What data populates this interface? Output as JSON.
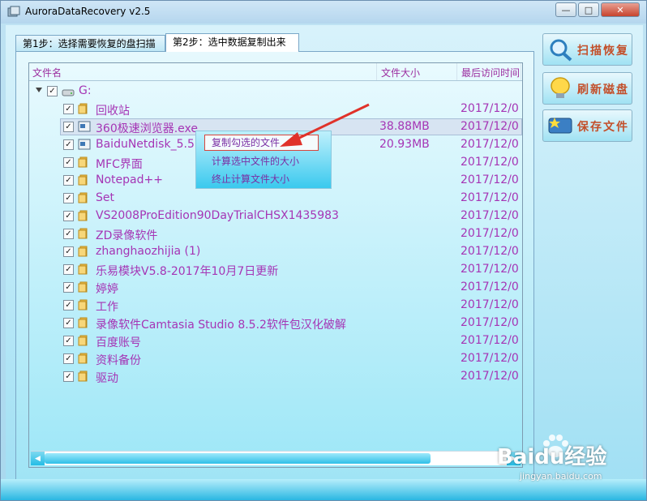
{
  "window": {
    "title": "AuroraDataRecovery v2.5"
  },
  "tabs": [
    {
      "label": "第1步：选择需要恢复的盘扫描"
    },
    {
      "label": "第2步：选中数据复制出来"
    }
  ],
  "columns": {
    "name": "文件名",
    "size": "文件大小",
    "date": "最后访问时间"
  },
  "drive": {
    "label": "G:"
  },
  "rows": [
    {
      "name": "回收站",
      "size": "",
      "date": "2017/12/0",
      "icon": "folder-icon"
    },
    {
      "name": "360极速浏览器.exe",
      "size": "38.88MB",
      "date": "2017/12/0",
      "icon": "file-icon",
      "selected": true
    },
    {
      "name": "BaiduNetdisk_5.5",
      "size": "20.93MB",
      "date": "2017/12/0",
      "icon": "file-icon"
    },
    {
      "name": "MFC界面",
      "size": "",
      "date": "2017/12/0",
      "icon": "folder-icon"
    },
    {
      "name": "Notepad++",
      "size": "",
      "date": "2017/12/0",
      "icon": "folder-icon"
    },
    {
      "name": "Set",
      "size": "",
      "date": "2017/12/0",
      "icon": "folder-icon"
    },
    {
      "name": "VS2008ProEdition90DayTrialCHSX1435983",
      "size": "",
      "date": "2017/12/0",
      "icon": "folder-icon"
    },
    {
      "name": "ZD录像软件",
      "size": "",
      "date": "2017/12/0",
      "icon": "folder-icon"
    },
    {
      "name": "zhanghaozhijia (1)",
      "size": "",
      "date": "2017/12/0",
      "icon": "folder-icon"
    },
    {
      "name": "乐易模块V5.8-2017年10月7日更新",
      "size": "",
      "date": "2017/12/0",
      "icon": "folder-icon"
    },
    {
      "name": "婷婷",
      "size": "",
      "date": "2017/12/0",
      "icon": "folder-icon"
    },
    {
      "name": "工作",
      "size": "",
      "date": "2017/12/0",
      "icon": "folder-icon"
    },
    {
      "name": "录像软件Camtasia Studio 8.5.2软件包汉化破解",
      "size": "",
      "date": "2017/12/0",
      "icon": "folder-icon"
    },
    {
      "name": "百度账号",
      "size": "",
      "date": "2017/12/0",
      "icon": "folder-icon"
    },
    {
      "name": "资料备份",
      "size": "",
      "date": "2017/12/0",
      "icon": "folder-icon"
    },
    {
      "name": "驱动",
      "size": "",
      "date": "2017/12/0",
      "icon": "folder-icon"
    }
  ],
  "context_menu": [
    {
      "label": "复制勾选的文件"
    },
    {
      "label": "计算选中文件的大小"
    },
    {
      "label": "终止计算文件大小"
    }
  ],
  "side_buttons": [
    {
      "label": "扫描恢复",
      "icon": "magnifier-icon"
    },
    {
      "label": "刷新磁盘",
      "icon": "bulb-icon"
    },
    {
      "label": "保存文件",
      "icon": "save-icon"
    }
  ],
  "watermark": {
    "main": "Baidu经验",
    "sub": "jingyan.baidu.com"
  },
  "colors": {
    "text_purple": "#a535b5",
    "menu_highlight_border": "#d8463d",
    "arrow_red": "#e0322a",
    "button_text": "#c34f2a"
  }
}
